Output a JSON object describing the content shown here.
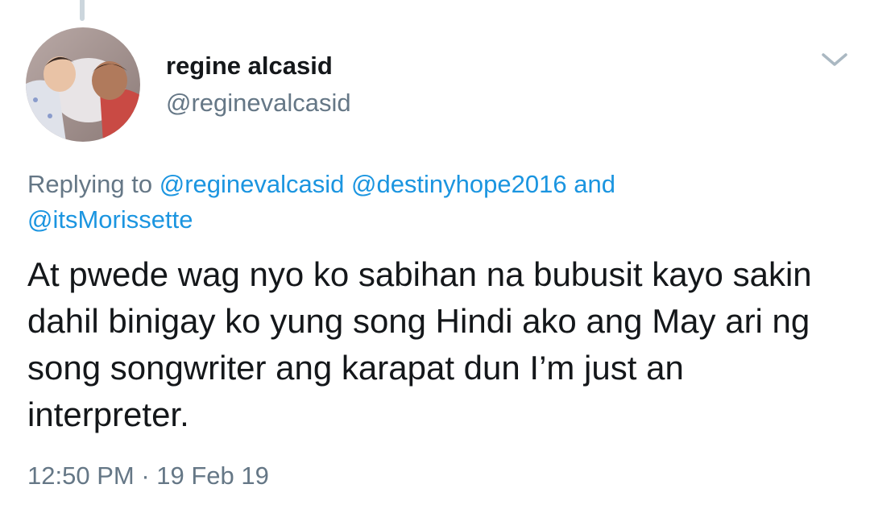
{
  "user": {
    "display_name": "regine alcasid",
    "handle": "@reginevalcasid"
  },
  "reply": {
    "prefix": "Replying to ",
    "mentions": [
      "@reginevalcasid",
      "@destinyhope2016",
      "@itsMorissette"
    ],
    "conjunction": "and"
  },
  "tweet": {
    "text": "At pwede wag nyo ko sabihan na bubusit kayo sakin dahil binigay ko yung song Hindi ako ang May ari ng song songwriter ang karapat dun I’m just an interpreter.",
    "time": "12:50 PM",
    "separator": " · ",
    "date": "19 Feb 19"
  },
  "icons": {
    "menu": "chevron-down-icon",
    "avatar": "profile-photo"
  },
  "colors": {
    "link": "#1b95e0",
    "secondary": "#657786",
    "text": "#14171a",
    "thread_line": "#ccd6dd"
  }
}
